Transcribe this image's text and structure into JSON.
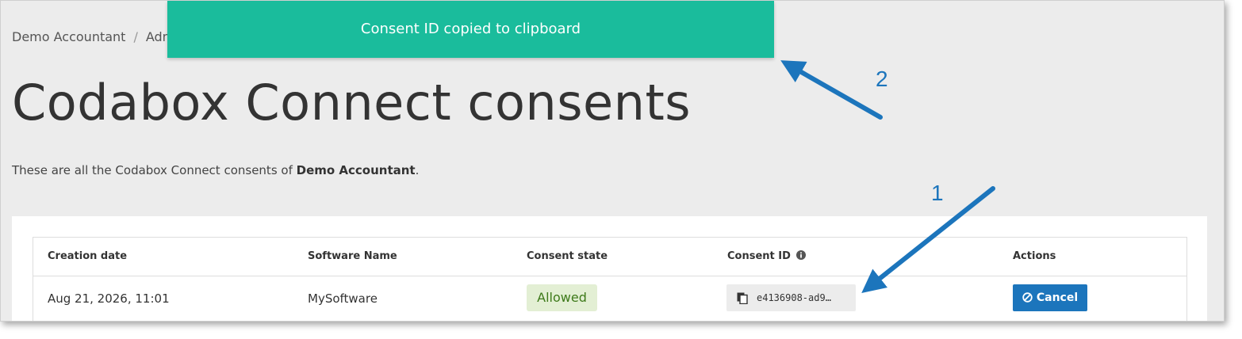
{
  "breadcrumb": {
    "item1": "Demo Accountant",
    "separator": "/",
    "item2": "Adm"
  },
  "page_title": "Codabox Connect consents",
  "intro": {
    "prefix": "These are all the Codabox Connect consents of ",
    "company": "Demo Accountant",
    "suffix": "."
  },
  "table": {
    "headers": [
      "Creation date",
      "Software Name",
      "Consent state",
      "Consent ID",
      "Actions"
    ],
    "row": {
      "creation_date": "Aug 21, 2026, 11:01",
      "software_name": "MySoftware",
      "consent_state": "Allowed",
      "consent_id": "e4136908-ad9…",
      "action_label": "Cancel"
    }
  },
  "toast": {
    "message": "Consent ID copied to clipboard"
  },
  "annotations": {
    "one": "1",
    "two": "2"
  },
  "icons": {
    "info": "info-icon",
    "copy": "copy-icon",
    "cancel": "cancel-circle-icon"
  },
  "colors": {
    "toast": "#1abc9c",
    "primary": "#1c75bc",
    "badge_bg": "#e3efd4",
    "badge_text": "#3e7a1a"
  }
}
